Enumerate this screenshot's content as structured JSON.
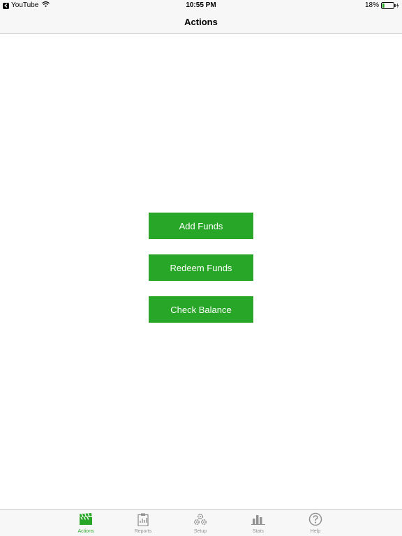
{
  "status_bar": {
    "back_app": "YouTube",
    "time": "10:55 PM",
    "battery_percent": "18%",
    "battery_level": 0.18
  },
  "nav": {
    "title": "Actions"
  },
  "actions": [
    {
      "label": "Add Funds"
    },
    {
      "label": "Redeem Funds"
    },
    {
      "label": "Check Balance"
    }
  ],
  "tabs": [
    {
      "label": "Actions",
      "icon": "clapperboard-icon",
      "active": true
    },
    {
      "label": "Reports",
      "icon": "clipboard-icon",
      "active": false
    },
    {
      "label": "Setup",
      "icon": "gears-icon",
      "active": false
    },
    {
      "label": "Stats",
      "icon": "bar-chart-icon",
      "active": false
    },
    {
      "label": "Help",
      "icon": "question-circle-icon",
      "active": false
    }
  ],
  "colors": {
    "accent": "#28a628",
    "inactive": "#929292",
    "bar_background": "#f7f7f7"
  }
}
